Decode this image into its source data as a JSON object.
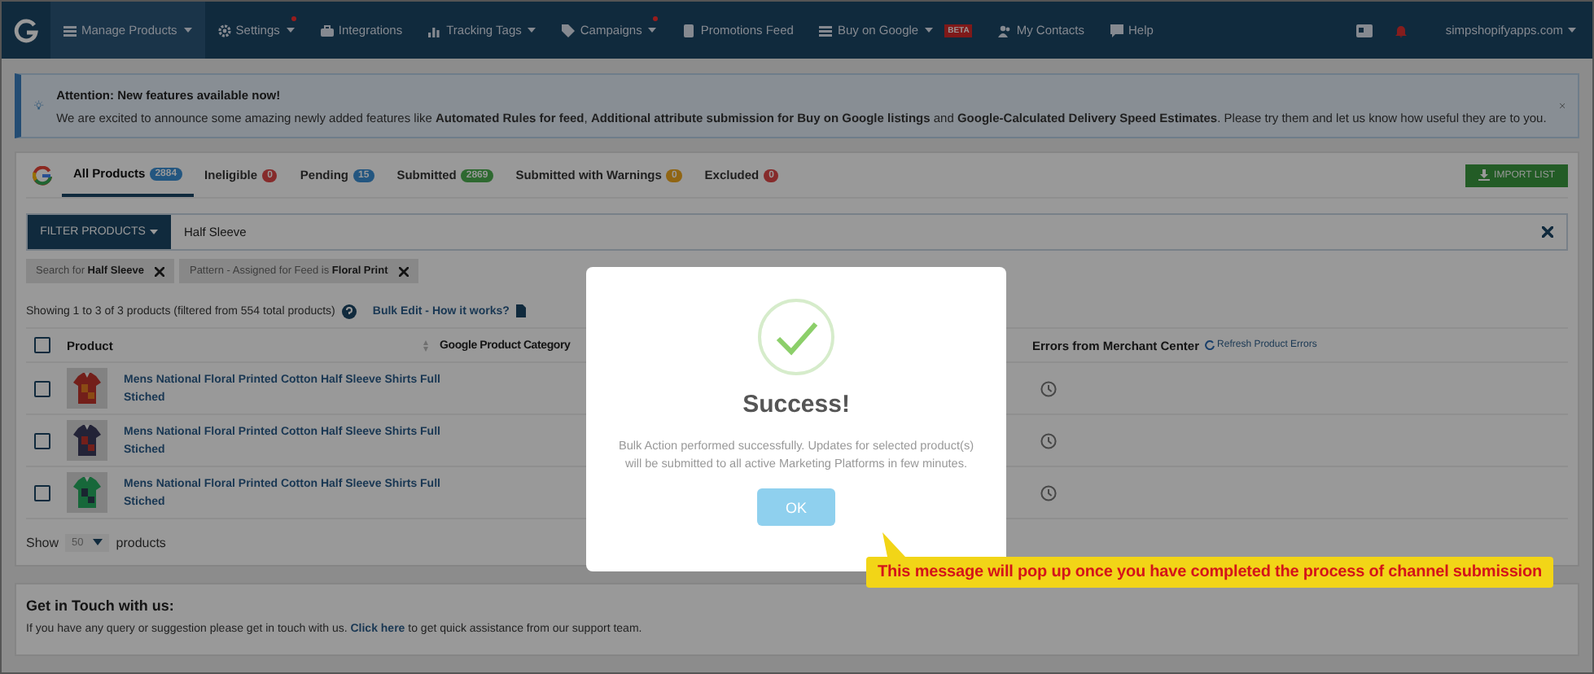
{
  "nav": {
    "items": [
      {
        "label": "Manage Products",
        "dropdown": true,
        "alert": false,
        "selected": true
      },
      {
        "label": "Settings",
        "dropdown": true,
        "alert": true,
        "selected": false
      },
      {
        "label": "Integrations",
        "dropdown": false,
        "alert": false,
        "selected": false
      },
      {
        "label": "Tracking Tags",
        "dropdown": true,
        "alert": false,
        "selected": false
      },
      {
        "label": "Campaigns",
        "dropdown": true,
        "alert": true,
        "selected": false
      },
      {
        "label": "Promotions Feed",
        "dropdown": false,
        "alert": false,
        "selected": false
      },
      {
        "label": "Buy on Google",
        "dropdown": true,
        "alert": false,
        "selected": false,
        "badge": "BETA"
      },
      {
        "label": "My Contacts",
        "dropdown": false,
        "alert": false,
        "selected": false
      },
      {
        "label": "Help",
        "dropdown": false,
        "alert": false,
        "selected": false
      }
    ],
    "account": "simpshopifyapps.com"
  },
  "notice": {
    "title": "Attention: New features available now!",
    "text": "We are excited to announce some amazing newly added features like **Automated Rules for feed**, **Additional attribute submission for Buy on Google listings** and **Google-Calculated Delivery Speed Estimates**. Please try them and let us know how useful they are to you."
  },
  "tabs": [
    {
      "label": "All Products",
      "count": "2884",
      "color": "#235680",
      "selected": true
    },
    {
      "label": "Ineligible",
      "count": "0",
      "color": "#862b2b",
      "selected": false
    },
    {
      "label": "Pending",
      "count": "15",
      "color": "#235680",
      "selected": false
    },
    {
      "label": "Submitted",
      "count": "2869",
      "color": "#2e6930",
      "selected": false
    },
    {
      "label": "Submitted with Warnings",
      "count": "0",
      "color": "#906513",
      "selected": false
    },
    {
      "label": "Excluded",
      "count": "0",
      "color": "#862b2b",
      "selected": false
    }
  ],
  "import_button": "IMPORT LIST",
  "filter": {
    "button": "FILTER PRODUCTS",
    "value": "Half Sleeve"
  },
  "chips": [
    "Search for **Half Sleeve**",
    "Pattern - Assigned for Feed is **Floral Print**"
  ],
  "summary": "Showing 1 to 3 of 3 products (filtered from 554 total products)",
  "bulk_link": "Bulk Edit - How it works?",
  "table": {
    "header_checked": false,
    "columns": [
      "Product",
      "Google Product Category",
      "Errors from Merchant Center"
    ],
    "refresh": "Refresh Product Errors",
    "rows": [
      {
        "title": "Mens National Floral Printed Cotton Half Sleeve Shirts Full Stiched",
        "checked": false
      },
      {
        "title": "Mens National Floral Printed Cotton Half Sleeve Shirts Full Stiched",
        "checked": false
      },
      {
        "title": "Mens National Floral Printed Cotton Half Sleeve Shirts Full Stiched",
        "checked": false
      }
    ]
  },
  "page_size": {
    "before": "Show",
    "value": "50",
    "after": "products"
  },
  "contact": {
    "title": "Get in Touch with us:",
    "text": "If you have any query or suggestion please get in touch with us.",
    "link": "Click here",
    "after": "to get quick assistance from our support team."
  },
  "modal": {
    "title": "Success!",
    "text": "Bulk Action performed successfully. Updates for selected product(s) will be submitted to all active Marketing Platforms in few minutes.",
    "button": "OK"
  },
  "callout": "This message will pop up once you have completed the process of channel submission"
}
